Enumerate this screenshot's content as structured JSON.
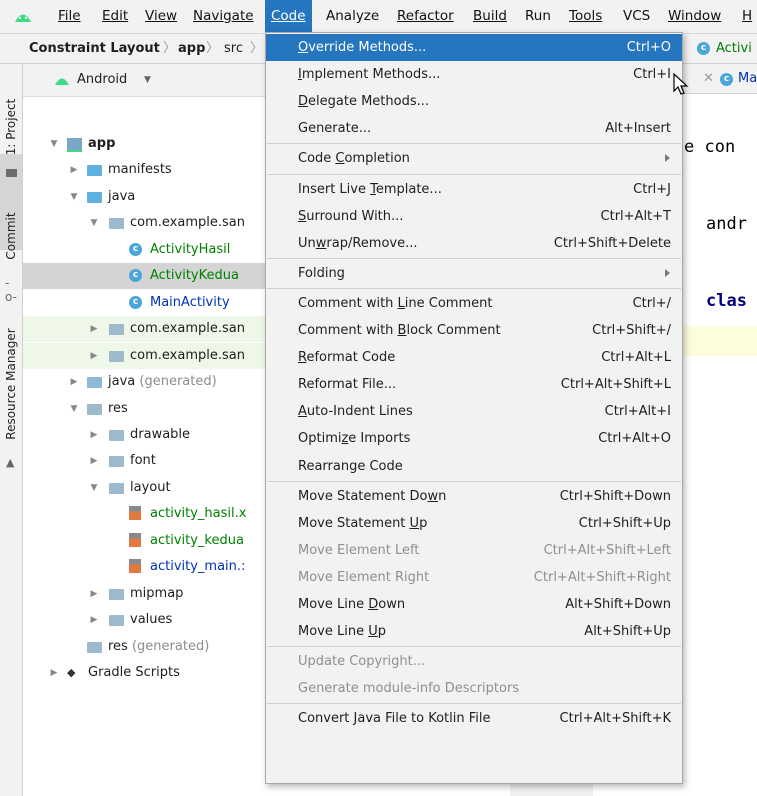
{
  "menubar": {
    "items": [
      "File",
      "Edit",
      "View",
      "Navigate",
      "Code",
      "Analyze",
      "Refactor",
      "Build",
      "Run",
      "Tools",
      "VCS",
      "Window",
      "H"
    ],
    "active": "Code"
  },
  "navbar": {
    "crumbs": [
      "Constraint Layout",
      "app",
      "src"
    ],
    "editor_tab": "Activi",
    "editor_tab2": "Ma"
  },
  "toolstrip": {
    "project": "1: Project",
    "commit": "Commit",
    "resource_manager": "Resource Manager"
  },
  "project_panel": {
    "view_selector": "Android",
    "tree": [
      {
        "label": "app",
        "bold": true,
        "depth": 0,
        "arrow": "down",
        "icon": "module-icon"
      },
      {
        "label": "manifests",
        "depth": 1,
        "arrow": "right",
        "icon": "folder-icon"
      },
      {
        "label": "java",
        "depth": 1,
        "arrow": "down",
        "icon": "folder-icon"
      },
      {
        "label": "com.example.san",
        "depth": 2,
        "arrow": "down",
        "icon": "package-icon"
      },
      {
        "label": "ActivityHasil",
        "depth": 3,
        "icon": "class-icon",
        "color": "#008000"
      },
      {
        "label": "ActivityKedua",
        "depth": 3,
        "icon": "class-icon",
        "color": "#008000",
        "selected": true
      },
      {
        "label": "MainActivity",
        "depth": 3,
        "icon": "class-icon",
        "color": "#0033b3"
      },
      {
        "label": "com.example.san",
        "depth": 2,
        "arrow": "right",
        "icon": "package-icon",
        "highlight": true
      },
      {
        "label": "com.example.san",
        "depth": 2,
        "arrow": "right",
        "icon": "package-icon",
        "highlight": true
      },
      {
        "label": "java",
        "suffix": " (generated)",
        "depth": 1,
        "arrow": "right",
        "icon": "generated-folder-icon"
      },
      {
        "label": "res",
        "depth": 1,
        "arrow": "down",
        "icon": "res-folder-icon"
      },
      {
        "label": "drawable",
        "depth": 2,
        "arrow": "right",
        "icon": "package-icon"
      },
      {
        "label": "font",
        "depth": 2,
        "arrow": "right",
        "icon": "package-icon"
      },
      {
        "label": "layout",
        "depth": 2,
        "arrow": "down",
        "icon": "package-icon"
      },
      {
        "label": "activity_hasil.x",
        "depth": 3,
        "icon": "layout-file-icon",
        "color": "#008000"
      },
      {
        "label": "activity_kedua",
        "depth": 3,
        "icon": "layout-file-icon",
        "color": "#008000"
      },
      {
        "label": "activity_main.:",
        "depth": 3,
        "icon": "layout-file-icon",
        "color": "#0033b3"
      },
      {
        "label": "mipmap",
        "depth": 2,
        "arrow": "right",
        "icon": "package-icon"
      },
      {
        "label": "values",
        "depth": 2,
        "arrow": "right",
        "icon": "package-icon"
      },
      {
        "label": "res",
        "suffix": " (generated)",
        "depth": 1,
        "icon": "res-folder-icon"
      },
      {
        "label": "Gradle Scripts",
        "depth": 0,
        "arrow": "right",
        "icon": "gradle-icon"
      }
    ]
  },
  "editor": {
    "line1": "e con",
    "line2": "andr",
    "line3": "clas"
  },
  "code_menu": {
    "items": [
      {
        "label": "Override Methods...",
        "u": 0,
        "shortcut": "Ctrl+O",
        "highlighted": true
      },
      {
        "label": "Implement Methods...",
        "u": 0,
        "shortcut": "Ctrl+I"
      },
      {
        "label": "Delegate Methods...",
        "u": 0,
        "shortcut": ""
      },
      {
        "label": "Generate...",
        "shortcut": "Alt+Insert"
      },
      {
        "sep": true
      },
      {
        "label": "Code Completion",
        "u": 5,
        "submenu": true
      },
      {
        "sep": true
      },
      {
        "label": "Insert Live Template...",
        "u": 12,
        "shortcut": "Ctrl+J"
      },
      {
        "label": "Surround With...",
        "u": 0,
        "shortcut": "Ctrl+Alt+T"
      },
      {
        "label": "Unwrap/Remove...",
        "u": 2,
        "shortcut": "Ctrl+Shift+Delete"
      },
      {
        "sep": true
      },
      {
        "label": "Folding",
        "submenu": true
      },
      {
        "sep": true
      },
      {
        "label": "Comment with Line Comment",
        "u": 13,
        "shortcut": "Ctrl+/"
      },
      {
        "label": "Comment with Block Comment",
        "u": 13,
        "shortcut": "Ctrl+Shift+/"
      },
      {
        "label": "Reformat Code",
        "u": 0,
        "shortcut": "Ctrl+Alt+L"
      },
      {
        "label": "Reformat File...",
        "shortcut": "Ctrl+Alt+Shift+L"
      },
      {
        "label": "Auto-Indent Lines",
        "u": 0,
        "shortcut": "Ctrl+Alt+I"
      },
      {
        "label": "Optimize Imports",
        "u": 6,
        "shortcut": "Ctrl+Alt+O"
      },
      {
        "label": "Rearrange Code",
        "shortcut": ""
      },
      {
        "sep": true
      },
      {
        "label": "Move Statement Down",
        "u": 17,
        "shortcut": "Ctrl+Shift+Down"
      },
      {
        "label": "Move Statement Up",
        "u": 15,
        "shortcut": "Ctrl+Shift+Up"
      },
      {
        "label": "Move Element Left",
        "shortcut": "Ctrl+Alt+Shift+Left",
        "disabled": true
      },
      {
        "label": "Move Element Right",
        "shortcut": "Ctrl+Alt+Shift+Right",
        "disabled": true
      },
      {
        "label": "Move Line Down",
        "u": 10,
        "shortcut": "Alt+Shift+Down"
      },
      {
        "label": "Move Line Up",
        "u": 10,
        "shortcut": "Alt+Shift+Up"
      },
      {
        "sep": true
      },
      {
        "label": "Update Copyright...",
        "shortcut": "",
        "disabled": true
      },
      {
        "label": "Generate module-info Descriptors",
        "shortcut": "",
        "disabled": true
      },
      {
        "sep": true
      },
      {
        "label": "Convert Java File to Kotlin File",
        "shortcut": "Ctrl+Alt+Shift+K"
      }
    ]
  }
}
